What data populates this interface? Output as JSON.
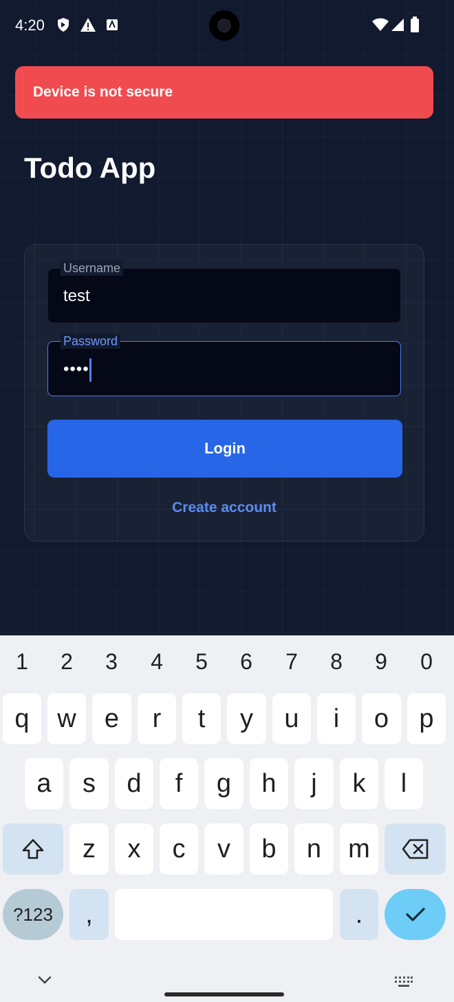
{
  "status_bar": {
    "time": "4:20"
  },
  "banner": {
    "text": "Device is not secure"
  },
  "app": {
    "title": "Todo App"
  },
  "login_form": {
    "username": {
      "label": "Username",
      "value": "test"
    },
    "password": {
      "label": "Password",
      "masked_value": "••••"
    },
    "login_label": "Login",
    "create_account_label": "Create account"
  },
  "keyboard": {
    "number_row": [
      "1",
      "2",
      "3",
      "4",
      "5",
      "6",
      "7",
      "8",
      "9",
      "0"
    ],
    "row1": [
      "q",
      "w",
      "e",
      "r",
      "t",
      "y",
      "u",
      "i",
      "o",
      "p"
    ],
    "row2": [
      "a",
      "s",
      "d",
      "f",
      "g",
      "h",
      "j",
      "k",
      "l"
    ],
    "row3": [
      "z",
      "x",
      "c",
      "v",
      "b",
      "n",
      "m"
    ],
    "symbols_label": "?123",
    "comma_label": ",",
    "period_label": "."
  },
  "colors": {
    "banner": "#f04c4f",
    "primary": "#2866e8",
    "background": "#111a2e",
    "enter_key": "#6dcdf7"
  }
}
